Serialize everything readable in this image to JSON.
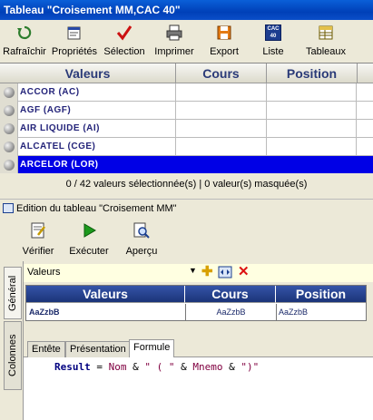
{
  "window": {
    "title": "Tableau \"Croisement MM,CAC 40\""
  },
  "toolbar": [
    {
      "label": "Rafraîchir",
      "icon": "refresh-icon"
    },
    {
      "label": "Propriétés",
      "icon": "properties-icon"
    },
    {
      "label": "Sélection",
      "icon": "selection-icon"
    },
    {
      "label": "Imprimer",
      "icon": "printer-icon"
    },
    {
      "label": "Export",
      "icon": "export-icon"
    },
    {
      "label": "Liste",
      "icon": "list-icon",
      "badge": "CAC 40"
    },
    {
      "label": "Tableaux",
      "icon": "tables-icon"
    }
  ],
  "grid": {
    "headers": [
      "Valeurs",
      "Cours",
      "Position"
    ],
    "rows": [
      {
        "valeur": "ACCOR (AC)",
        "cours": "",
        "position": ""
      },
      {
        "valeur": "AGF (AGF)",
        "cours": "",
        "position": ""
      },
      {
        "valeur": "AIR LIQUIDE (AI)",
        "cours": "",
        "position": ""
      },
      {
        "valeur": "ALCATEL (CGE)",
        "cours": "",
        "position": ""
      },
      {
        "valeur": "ARCELOR (LOR)",
        "cours": "",
        "position": "",
        "selected": true
      }
    ]
  },
  "status": {
    "text": "0 / 42 valeurs sélectionnée(s) | 0 valeur(s) masquée(s)"
  },
  "editor": {
    "title": "Edition du tableau \"Croisement MM\"",
    "toolbar": [
      {
        "label": "Vérifier",
        "icon": "verify-icon"
      },
      {
        "label": "Exécuter",
        "icon": "play-icon"
      },
      {
        "label": "Aperçu",
        "icon": "preview-icon"
      }
    ],
    "side_tabs": [
      "Général",
      "Colonnes"
    ],
    "field_label": "Valeurs",
    "preview": {
      "headers": [
        "Valeurs",
        "Cours",
        "Position"
      ],
      "cells": [
        "AaZzbB",
        "AaZzbB",
        "AaZzbB"
      ]
    },
    "bottom_tabs": [
      "Entête",
      "Présentation",
      "Formule"
    ],
    "formula": {
      "keyword": "Result",
      "eq": " = ",
      "id1": "Nom",
      "op1": " & ",
      "s1": "\" ( \"",
      "op2": " & ",
      "id2": "Mnemo",
      "op3": " & ",
      "s2": "\")\""
    }
  },
  "colors": {
    "selected_row": "#0000e6",
    "title_bar": "#0040b8",
    "grid_header_text": "#2a3a78"
  }
}
